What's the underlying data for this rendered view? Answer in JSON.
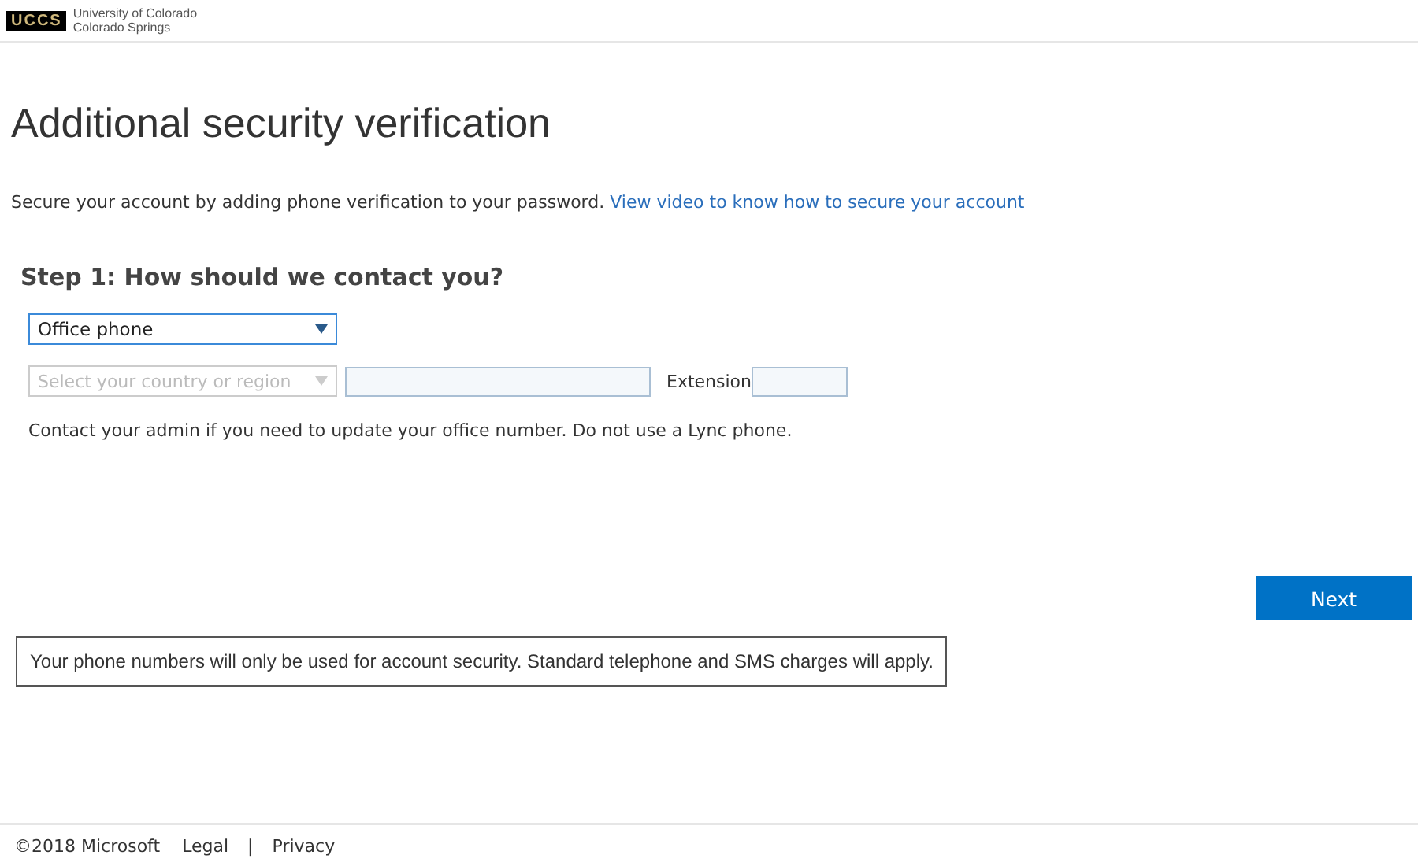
{
  "header": {
    "logo_mark": "UCCS",
    "logo_text": [
      "University of Colorado",
      "Colorado Springs"
    ]
  },
  "title": "Additional security verification",
  "intro": {
    "text": "Secure your account by adding phone verification to your password.",
    "link": "View video to know how to secure your account"
  },
  "step": {
    "heading": "Step 1: How should we contact you?",
    "method": {
      "value": "Office phone",
      "disabled": false
    },
    "country": {
      "placeholder": "Select your country or region",
      "disabled": true
    },
    "extension_label": "Extension",
    "note": "Contact your admin if you need to update your office number. Do not use a Lync phone."
  },
  "next_button": "Next",
  "disclaimer": "Your phone numbers will only be used for account security. Standard telephone and SMS charges will apply.",
  "footer": {
    "copyright": "©2018 Microsoft",
    "links": [
      "Legal",
      "Privacy"
    ],
    "separator": "|"
  }
}
